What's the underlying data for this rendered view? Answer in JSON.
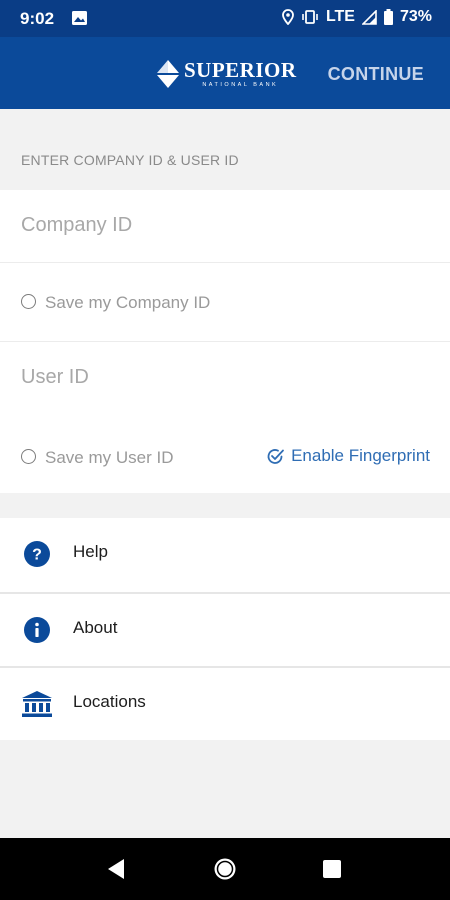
{
  "status_bar": {
    "time": "9:02",
    "network": "LTE",
    "battery": "73%",
    "icons": [
      "image-icon",
      "location-icon",
      "vibrate-icon",
      "signal-icon",
      "battery-icon"
    ]
  },
  "app_bar": {
    "brand_name": "SUPERIOR",
    "brand_subtitle": "NATIONAL BANK",
    "continue_label": "CONTINUE"
  },
  "form": {
    "section_header": "ENTER COMPANY ID & USER ID",
    "company_id_placeholder": "Company ID",
    "save_company_label": "Save my Company ID",
    "user_id_placeholder": "User ID",
    "save_user_label": "Save my User ID",
    "fingerprint_label": "Enable Fingerprint"
  },
  "menu": {
    "items": [
      {
        "label": "Help",
        "icon": "help-icon"
      },
      {
        "label": "About",
        "icon": "info-icon"
      },
      {
        "label": "Locations",
        "icon": "bank-icon"
      }
    ]
  },
  "colors": {
    "app_bar": "#0b4a9a",
    "status_bar": "#0a3d86",
    "accent": "#2f6db4",
    "background": "#f2f2f2"
  }
}
